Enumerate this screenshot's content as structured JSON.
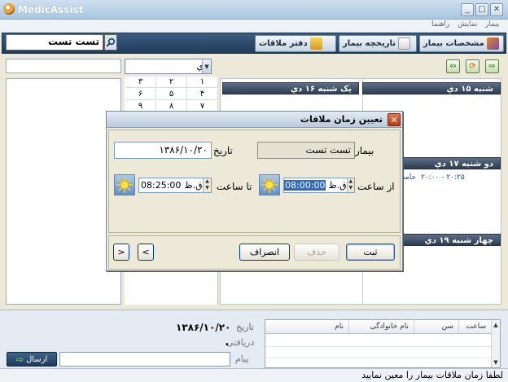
{
  "window": {
    "title": "MedicAssist",
    "controls": [
      "_",
      "□",
      "✕"
    ]
  },
  "menu": [
    "بیمار",
    "نمایش",
    "راهنما"
  ],
  "toolbar": {
    "search_value": "تست تست",
    "buttons": [
      {
        "label": "مشخصات بیمار"
      },
      {
        "label": "تاریخچه بیمار"
      },
      {
        "label": "دفتر ملاقات"
      }
    ]
  },
  "calendar": {
    "month_value": "دي",
    "rows": [
      [
        "۳",
        "۲",
        "۱"
      ],
      [
        "۶",
        "۵",
        "۴"
      ],
      [
        "۹",
        "۸",
        "۷"
      ]
    ]
  },
  "days": {
    "col_right": [
      {
        "header": "شنبه ۱۵ دي",
        "entries": []
      },
      {
        "header": "دو شنبه ۱۷ دي",
        "entries": [
          {
            "time": "۲۰:۰۰ - ۲۰:۲۵",
            "name": "حامد موسوی"
          }
        ]
      },
      {
        "header": "چهار شنبه ۱۹ دي",
        "entries": []
      }
    ],
    "col_left": [
      {
        "header": "يک شنبه ۱۶ دي"
      }
    ]
  },
  "dialog": {
    "title": "تعیین زمان ملاقات",
    "patient_label": "بیمار",
    "patient_value": "تست تست",
    "date_label": "تاریخ",
    "date_value": "۱۳۸۶/۱۰/۲۰",
    "from_label": "از ساعت",
    "from_ampm": "ق.ظ",
    "from_time": "08:00:00",
    "to_label": "تا ساعت",
    "to_ampm": "ق.ظ",
    "to_time": "08:25:00",
    "btn_submit": "ثبت",
    "btn_delete": "حذف",
    "btn_cancel": "انصراف",
    "nav_prev": "<",
    "nav_next": ">"
  },
  "bottom": {
    "date_label": "تاریخ",
    "date_value": "۱۳۸۶/۱۰/۲۰",
    "received_label": "دریافتی",
    "message_label": "پیام",
    "send_label": "ارسال",
    "table_headers": [
      "ساعت",
      "سن",
      "نام خانوادگی",
      "نام"
    ]
  },
  "status": "لطفا زمان ملاقات بیمار را معین نمایید"
}
